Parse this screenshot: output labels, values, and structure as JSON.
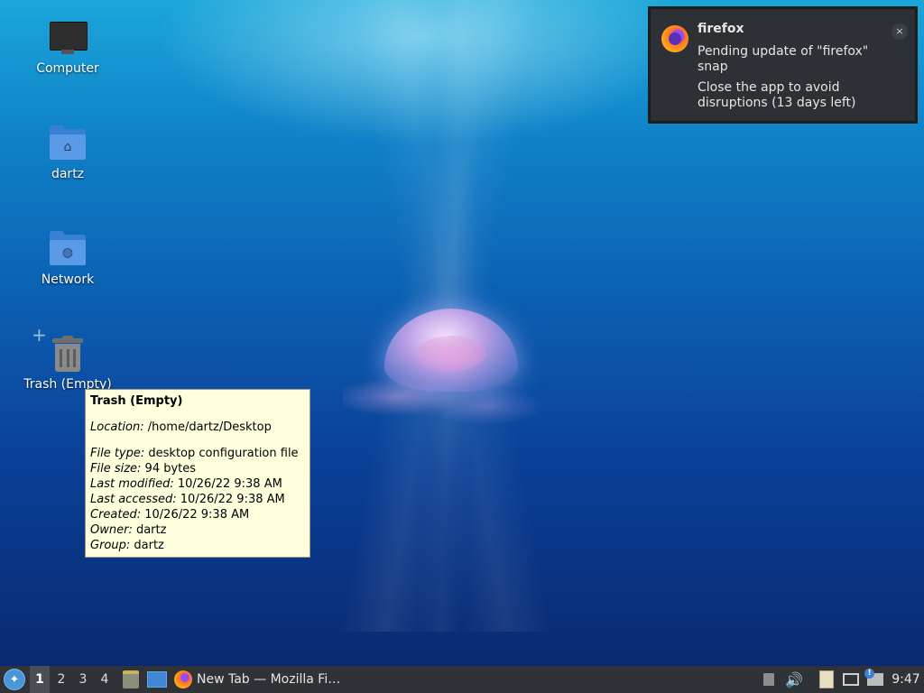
{
  "desktop": {
    "icons": [
      {
        "label": "Computer",
        "icon": "computer-icon"
      },
      {
        "label": "dartz",
        "icon": "home-folder-icon"
      },
      {
        "label": "Network",
        "icon": "network-folder-icon"
      },
      {
        "label": "Trash (Empty)",
        "icon": "trash-icon"
      }
    ]
  },
  "tooltip": {
    "title": "Trash (Empty)",
    "location": {
      "key": "Location:",
      "value": " /home/dartz/Desktop"
    },
    "file_type": {
      "key": "File type:",
      "value": " desktop configuration file"
    },
    "file_size": {
      "key": "File size:",
      "value": " 94 bytes"
    },
    "last_modified": {
      "key": "Last modified:",
      "value": " 10/26/22 9:38 AM"
    },
    "last_accessed": {
      "key": "Last accessed:",
      "value": " 10/26/22 9:38 AM"
    },
    "created": {
      "key": "Created:",
      "value": " 10/26/22 9:38 AM"
    },
    "owner": {
      "key": "Owner:",
      "value": " dartz"
    },
    "group": {
      "key": "Group:",
      "value": " dartz"
    }
  },
  "notification": {
    "app": "firefox",
    "line1": "Pending update of \"firefox\" snap",
    "line2": "Close the app to avoid disruptions (13 days left)",
    "close_glyph": "×",
    "icon": "firefox-logo-icon",
    "background": "#2d3035"
  },
  "taskbar": {
    "workspaces": [
      "1",
      "2",
      "3",
      "4"
    ],
    "active_workspace": "1",
    "task_title": "New Tab — Mozilla Fi…",
    "clock": "9:47",
    "background": "#2f3338"
  }
}
